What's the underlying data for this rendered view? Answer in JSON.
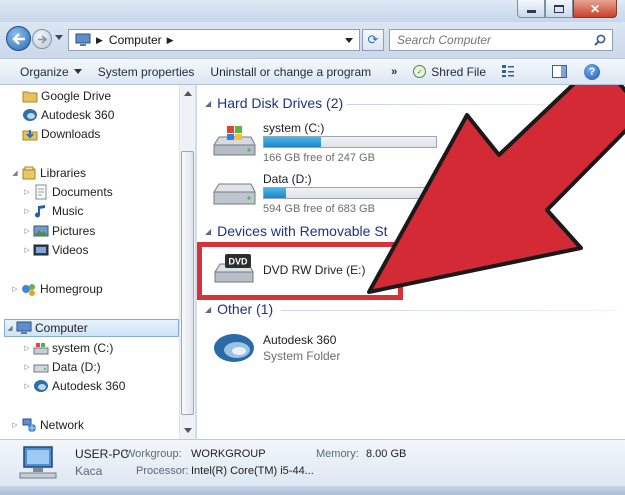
{
  "window": {
    "buttons": [
      "minimize",
      "maximize",
      "close"
    ]
  },
  "address": {
    "crumb": "Computer",
    "search_placeholder": "Search Computer"
  },
  "toolbar": {
    "organize": "Organize",
    "system_properties": "System properties",
    "uninstall": "Uninstall or change a program",
    "more": "»",
    "shred": "Shred File"
  },
  "nav": {
    "favorites": [
      {
        "label": "Google Drive",
        "icon": "folder-icon"
      },
      {
        "label": "Autodesk 360",
        "icon": "autodesk-icon"
      },
      {
        "label": "Downloads",
        "icon": "downloads-icon"
      }
    ],
    "libraries": {
      "label": "Libraries",
      "items": [
        "Documents",
        "Music",
        "Pictures",
        "Videos"
      ]
    },
    "homegroup": "Homegroup",
    "computer": {
      "label": "Computer",
      "items": [
        "system (C:)",
        "Data (D:)",
        "Autodesk 360"
      ]
    },
    "network": "Network"
  },
  "content": {
    "hard_disk": {
      "header": "Hard Disk Drives (2)",
      "drives": [
        {
          "name": "system (C:)",
          "free": "166 GB free of 247 GB",
          "used_fraction": 0.33
        },
        {
          "name": "Data (D:)",
          "free": "594 GB free of 683 GB",
          "used_fraction": 0.13
        }
      ]
    },
    "removable": {
      "header": "Devices with Removable St",
      "drive": "DVD RW Drive (E:)",
      "dvd_badge": "DVD"
    },
    "other": {
      "header": "Other (1)",
      "item_name": "Autodesk 360",
      "item_sub": "System Folder"
    }
  },
  "details": {
    "pc_name": "USER-PC",
    "user": "Kaca",
    "workgroup_label": "Workgroup:",
    "workgroup_value": "WORKGROUP",
    "memory_label": "Memory:",
    "memory_value": "8.00 GB",
    "processor_label": "Processor:",
    "processor_value": "Intel(R) Core(TM) i5-44..."
  },
  "colors": {
    "header_blue": "#1e3287",
    "highlight_red": "#d7313a",
    "arrow_red": "#d32a35",
    "drive_bar": "#1e86c8"
  }
}
